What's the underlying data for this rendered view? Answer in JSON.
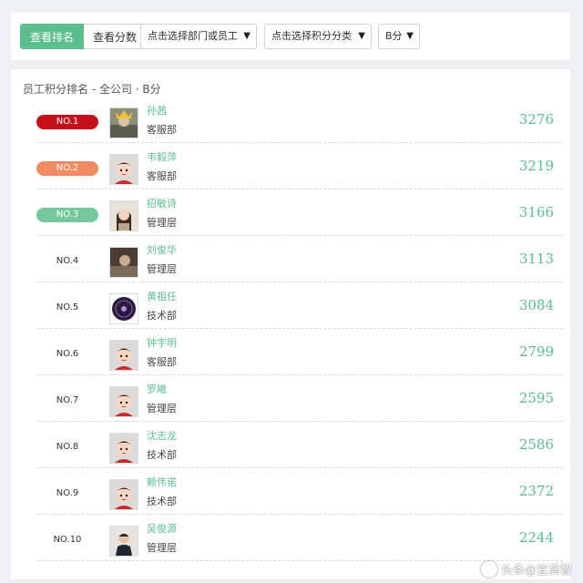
{
  "toolbar": {
    "view_ranking": "查看排名",
    "view_score": "查看分数",
    "select_dept": "点击选择部门或员工",
    "select_category": "点击选择积分分类",
    "select_grade": "B分"
  },
  "panel": {
    "title": "员工积分排名 - 全公司  · B分"
  },
  "rows": [
    {
      "rank": "NO.1",
      "name": "孙茜",
      "dept": "客服部",
      "score": "3276",
      "avatar": "crown-photo"
    },
    {
      "rank": "NO.2",
      "name": "韦毅萍",
      "dept": "客服部",
      "score": "3219",
      "avatar": "cartoon"
    },
    {
      "rank": "NO.3",
      "name": "招敏诗",
      "dept": "管理层",
      "score": "3166",
      "avatar": "photo-woman"
    },
    {
      "rank": "NO.4",
      "name": "刘俊华",
      "dept": "管理层",
      "score": "3113",
      "avatar": "photo-dark"
    },
    {
      "rank": "NO.5",
      "name": "黄祖任",
      "dept": "技术部",
      "score": "3084",
      "avatar": "logo-circle"
    },
    {
      "rank": "NO.6",
      "name": "钟宇明",
      "dept": "客服部",
      "score": "2799",
      "avatar": "cartoon"
    },
    {
      "rank": "NO.7",
      "name": "罗曦",
      "dept": "管理层",
      "score": "2595",
      "avatar": "cartoon"
    },
    {
      "rank": "NO.8",
      "name": "沈志龙",
      "dept": "技术部",
      "score": "2586",
      "avatar": "cartoon"
    },
    {
      "rank": "NO.9",
      "name": "赖伟诺",
      "dept": "技术部",
      "score": "2372",
      "avatar": "cartoon"
    },
    {
      "rank": "NO.10",
      "name": "吴俊源",
      "dept": "管理层",
      "score": "2244",
      "avatar": "photo-man"
    }
  ],
  "watermark": "头条@宜高智"
}
